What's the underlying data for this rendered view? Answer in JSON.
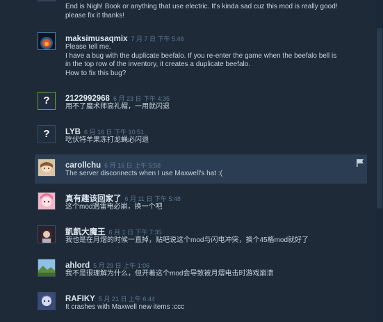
{
  "comments": [
    {
      "author": "",
      "time": "",
      "lines": [
        "End is Nigh! Book or anything that use electric. It's kinda sad cuz this mod is really good!",
        "please fix it thanks!"
      ],
      "avatar": "partial-avatar"
    },
    {
      "author": "maksimusaqmix",
      "time": "7 月 7 日 下午 5:46",
      "lines": [
        "Please tell me.",
        "I have a bug with the duplicate beefalo. If you re-enter the game when the beefalo bell is",
        "in the top row of the inventory, it creates a duplicate beefalo.",
        "How to fix this bug?"
      ],
      "avatar": "sunset-planet-avatar"
    },
    {
      "author": "2122992968",
      "time": "6 月 23 日 下午 4:35",
      "lines": [
        "用不了魔术师高礼帽，一用就闪退"
      ],
      "avatar": "question-mark-avatar"
    },
    {
      "author": "LYB",
      "time": "6 月 16 日 下午 10:51",
      "lines": [
        "吃伏特羊果冻打龙蝇必闪退"
      ],
      "avatar": "question-mark-avatar"
    },
    {
      "author": "carollchu",
      "time": "6 月 16 日 上午 5:58",
      "lines": [
        "The server disconnects when I use Maxwell's hat :("
      ],
      "avatar": "anime-girl-avatar",
      "flag_icon": "flag-icon"
    },
    {
      "author": "真有趣该回家了",
      "time": "6 月 11 日 下午 5:48",
      "lines": [
        "这个mod遇雷电必崩，换一个吧"
      ],
      "avatar": "pink-hair-avatar"
    },
    {
      "author": "凱凱大魔王",
      "time": "6 月 1 日 下午 7:35",
      "lines": [
        "我也是在月熠的时候一直掉，贴吧说这个mod与闪电冲突，换个45格mod就好了"
      ],
      "avatar": "portrait-avatar"
    },
    {
      "author": "ahlord",
      "time": "5 月 29 日 上午 1:06",
      "lines": [
        "我不是很理解为什么，但开着这个mod会导致被月熠电击时游戏崩溃"
      ],
      "avatar": "landscape-avatar"
    },
    {
      "author": "RAFIKY",
      "time": "5 月 21 日 上午 6:44",
      "lines": [
        "It crashes with Maxwell new items :ccc"
      ],
      "avatar": "character-avatar"
    }
  ],
  "colors": {
    "background": "#1b2838",
    "highlight": "#2a3d52",
    "author": "#dde6ee",
    "timestamp": "#5e7a92",
    "text": "#c6d4df"
  }
}
